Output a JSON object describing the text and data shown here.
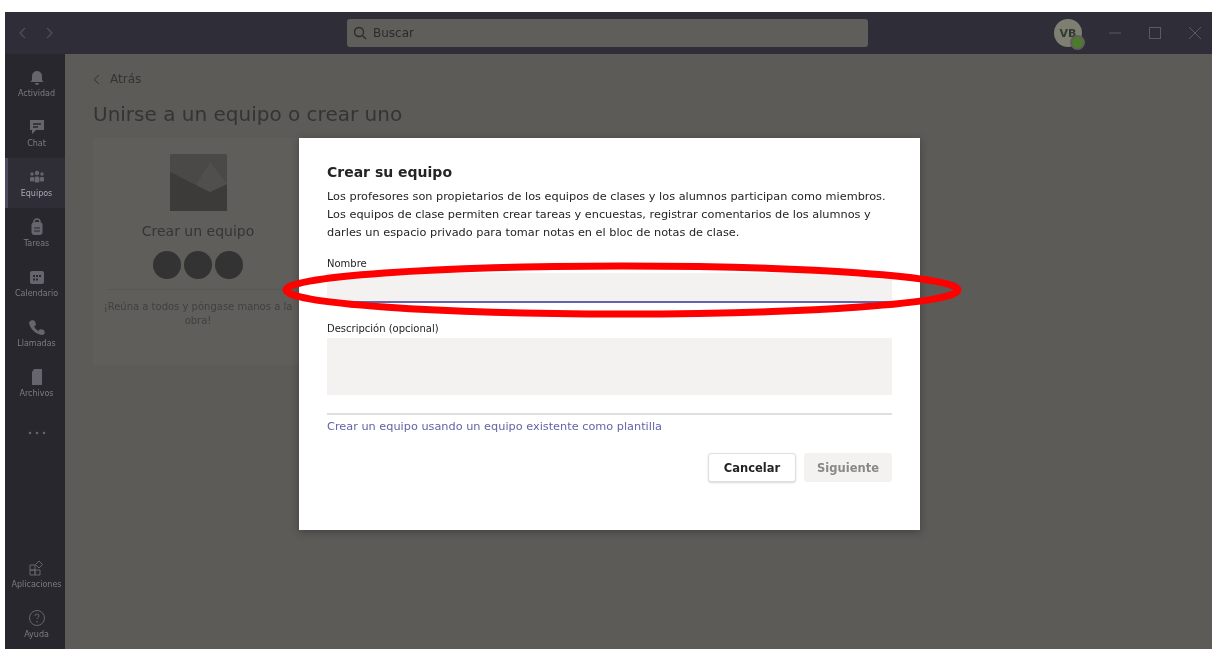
{
  "titlebar": {
    "search": {
      "placeholder": "Buscar"
    },
    "avatar": {
      "initials": "VB",
      "online": true
    }
  },
  "sidebar": {
    "items": [
      {
        "label": "Actividad",
        "selected": false
      },
      {
        "label": "Chat",
        "selected": false
      },
      {
        "label": "Equipos",
        "selected": true
      },
      {
        "label": "Tareas",
        "selected": false
      },
      {
        "label": "Calendario",
        "selected": false
      },
      {
        "label": "Llamadas",
        "selected": false
      },
      {
        "label": "Archivos",
        "selected": false
      }
    ],
    "bottom_items": [
      {
        "label": "Aplicaciones"
      },
      {
        "label": "Ayuda"
      }
    ]
  },
  "page": {
    "back": "Atrás",
    "title": "Unirse a un equipo o crear uno",
    "card": {
      "title": "Crear un equipo",
      "text": "¡Reúna a todos y póngase manos a la obra!"
    }
  },
  "dialog": {
    "title": "Crear su equipo",
    "description": "Los profesores son propietarios de los equipos de clases y los alumnos participan como miembros. Los equipos de clase permiten crear tareas y encuestas, registrar comentarios de los alumnos y darles un espacio privado para tomar notas en el bloc de notas de clase.",
    "fields": [
      {
        "label": "Nombre",
        "kind": "input",
        "focused": true
      },
      {
        "label": "Descripción (opcional)",
        "kind": "textarea",
        "focused": false
      }
    ],
    "link": "Crear un equipo usando un equipo existente como plantilla",
    "buttons": [
      {
        "label": "Cancelar",
        "disabled": false
      },
      {
        "label": "Siguiente",
        "disabled": true
      }
    ]
  }
}
